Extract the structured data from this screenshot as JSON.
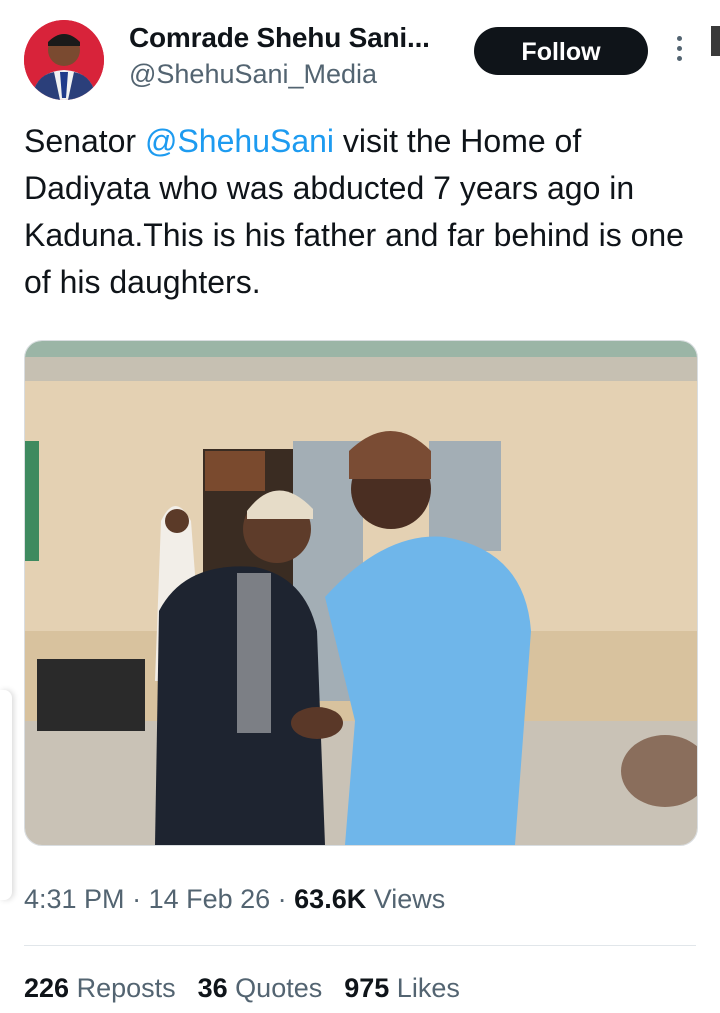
{
  "author": {
    "name": "Comrade Shehu Sani...",
    "handle": "@ShehuSani_Media",
    "follow_label": "Follow"
  },
  "tweet": {
    "text_before": "Senator ",
    "mention": "@ShehuSani",
    "text_after": " visit the Home of Dadiyata who was abducted 7 years ago in Kaduna.This is his father and far behind is one of his daughters."
  },
  "meta": {
    "time": "4:31 PM",
    "sep1": " · ",
    "date": "14 Feb 26",
    "sep2": " · ",
    "views_count": "63.6K",
    "views_label": " Views"
  },
  "stats": {
    "reposts_count": "226",
    "reposts_label": " Reposts",
    "quotes_count": "36",
    "quotes_label": " Quotes",
    "likes_count": "975",
    "likes_label": " Likes"
  },
  "icons": {
    "more": "more-vertical-icon"
  },
  "colors": {
    "link": "#1d9bf0",
    "follow_bg": "#0f1419",
    "secondary_text": "#536471"
  }
}
